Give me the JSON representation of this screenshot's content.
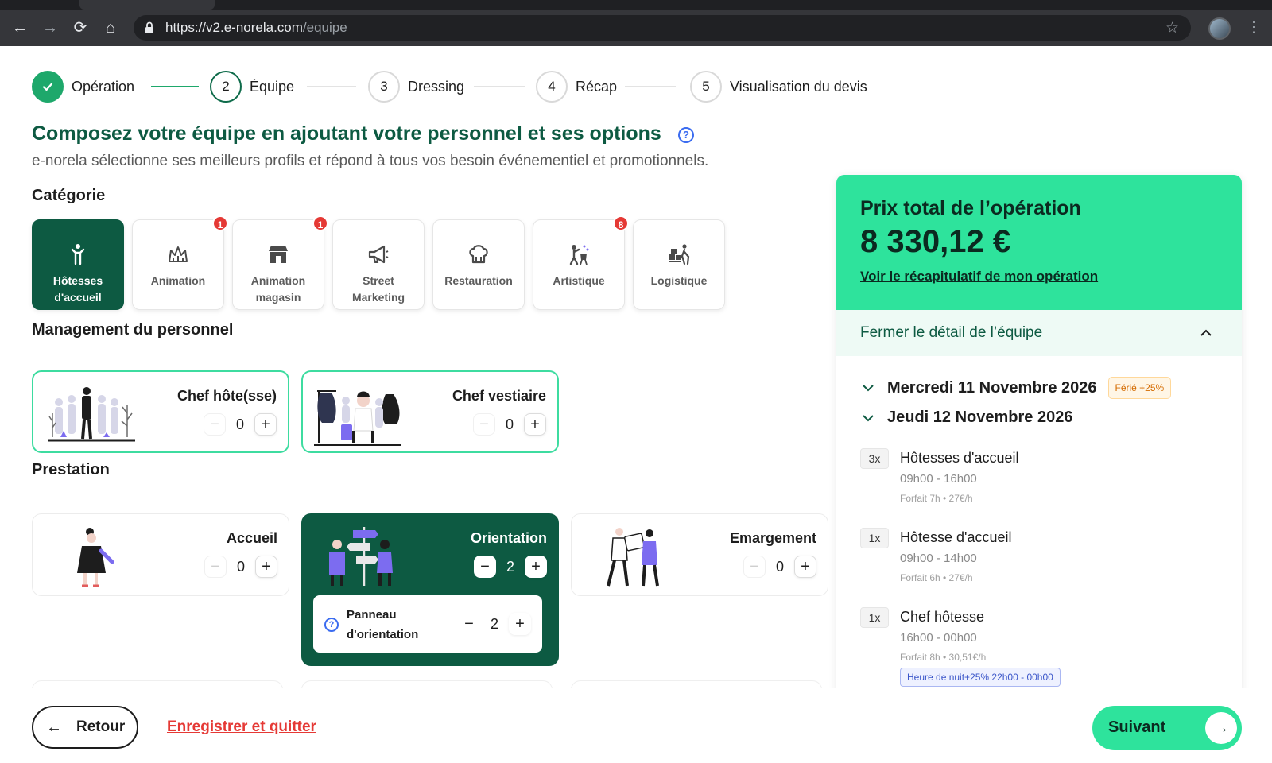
{
  "browser": {
    "url_host": "https://v2.e-norela.com",
    "url_path": "/equipe",
    "nav_back": "←",
    "nav_forward": "→",
    "nav_reload": "⟳",
    "nav_home": "⌂",
    "star": "☆",
    "kebab": "⋮"
  },
  "stepper": {
    "steps": [
      {
        "number": "✓",
        "label": "Opération",
        "state": "done"
      },
      {
        "number": "2",
        "label": "Équipe",
        "state": "active"
      },
      {
        "number": "3",
        "label": "Dressing",
        "state": "todo"
      },
      {
        "number": "4",
        "label": "Récap",
        "state": "todo"
      },
      {
        "number": "5",
        "label": "Visualisation du devis",
        "state": "todo"
      }
    ]
  },
  "header": {
    "title": "Composez votre équipe en ajoutant votre personnel et ses options",
    "help": "?",
    "subtitle": "e-norela sélectionne ses meilleurs profils et répond à tous vos besoin événementiel et promotionnels."
  },
  "categories": {
    "title": "Catégorie",
    "items": [
      {
        "label_1": "Hôtesses",
        "label_2": "d'accueil",
        "icon": "host-icon",
        "selected": true,
        "badge": ""
      },
      {
        "label_1": "Animation",
        "label_2": "",
        "icon": "crown-icon",
        "selected": false,
        "badge": "1"
      },
      {
        "label_1": "Animation",
        "label_2": "magasin",
        "icon": "shop-icon",
        "selected": false,
        "badge": "1"
      },
      {
        "label_1": "Street",
        "label_2": "Marketing",
        "icon": "megaphone-icon",
        "selected": false,
        "badge": ""
      },
      {
        "label_1": "Restauration",
        "label_2": "",
        "icon": "chef-hat-icon",
        "selected": false,
        "badge": ""
      },
      {
        "label_1": "Artistique",
        "label_2": "",
        "icon": "artist-icon",
        "selected": false,
        "badge": "8"
      },
      {
        "label_1": "Logistique",
        "label_2": "",
        "icon": "trolley-icon",
        "selected": false,
        "badge": ""
      }
    ]
  },
  "management": {
    "title": "Management du personnel",
    "items": [
      {
        "label": "Chef hôte(sse)",
        "value": "0"
      },
      {
        "label": "Chef vestiaire",
        "value": "0"
      }
    ]
  },
  "prestation": {
    "title": "Prestation",
    "items": [
      {
        "label": "Accueil",
        "value": "0"
      },
      {
        "label": "Orientation",
        "value": "2",
        "option_label": "Panneau d'orientation",
        "option_value": "2"
      },
      {
        "label": "Emargement",
        "value": "0"
      }
    ]
  },
  "controls": {
    "minus": "−",
    "plus": "+"
  },
  "summary": {
    "title": "Prix total de l’opération",
    "price": "8 330,12 €",
    "link": "Voir le récapitulatif de mon opération",
    "toggle_label": "Fermer le détail de l’équipe",
    "days": [
      {
        "label": "Mercredi 11 Novembre 2026",
        "badge": "Férié +25%"
      },
      {
        "label": "Jeudi 12 Novembre 2026",
        "badge": ""
      }
    ],
    "lines": [
      {
        "qty": "3x",
        "title": "Hôtesses d'accueil",
        "time": "09h00 - 16h00",
        "forfait": "Forfait 7h • 27€/h",
        "extra": ""
      },
      {
        "qty": "1x",
        "title": "Hôtesse d'accueil",
        "time": "09h00 - 14h00",
        "forfait": "Forfait 6h • 27€/h",
        "extra": ""
      },
      {
        "qty": "1x",
        "title": "Chef hôtesse",
        "time": "16h00 - 00h00",
        "forfait": "Forfait 8h • 30,51€/h",
        "extra": "Heure de nuit+25% 22h00 - 00h00"
      }
    ]
  },
  "footer": {
    "back_label": "Retour",
    "back_arrow": "←",
    "save_label": "Enregistrer et quitter",
    "next_label": "Suivant",
    "next_arrow": "→"
  },
  "colors": {
    "brand_dark": "#0d5a42",
    "brand_mint": "#2ee39c",
    "accent_green": "#1ea86b",
    "danger": "#e53935",
    "link_blue": "#3b6cf0"
  }
}
